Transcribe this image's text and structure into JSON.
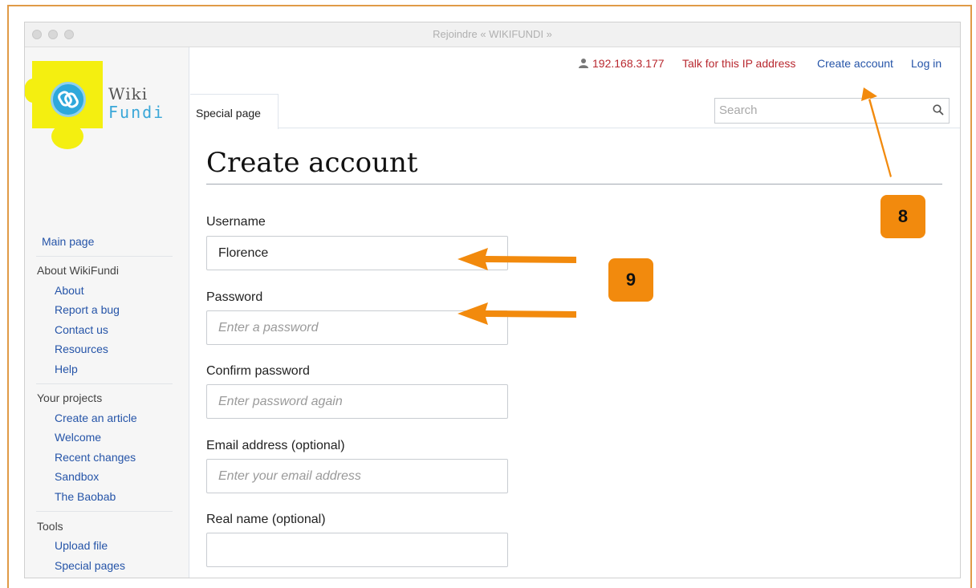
{
  "window": {
    "title": "Rejoindre « WIKIFUNDI »"
  },
  "personal_bar": {
    "ip": "192.168.3.177",
    "talk": "Talk for this IP address",
    "create_account": "Create account",
    "login": "Log in"
  },
  "logo": {
    "line1": "Wiki",
    "line2": "Fundi"
  },
  "sidebar": {
    "main_page": "Main page",
    "about_heading": "About WikiFundi",
    "about_items": [
      "About",
      "Report a bug",
      "Contact us",
      "Resources",
      "Help"
    ],
    "projects_heading": "Your projects",
    "projects_items": [
      "Create an article",
      "Welcome",
      "Recent changes",
      "Sandbox",
      "The Baobab"
    ],
    "tools_heading": "Tools",
    "tools_items": [
      "Upload file",
      "Special pages"
    ]
  },
  "tabs": {
    "special_page": "Special page"
  },
  "search": {
    "placeholder": "Search"
  },
  "page": {
    "title": "Create account"
  },
  "form": {
    "username_label": "Username",
    "username_value": "Florence",
    "password_label": "Password",
    "password_placeholder": "Enter a password",
    "confirm_label": "Confirm password",
    "confirm_placeholder": "Enter password again",
    "email_label": "Email address (optional)",
    "email_placeholder": "Enter your email address",
    "realname_label": "Real name (optional)",
    "realname_value": ""
  },
  "annotations": {
    "badge_8": "8",
    "badge_9": "9"
  },
  "colors": {
    "accent_orange": "#f28a0d",
    "link_blue": "#2554a8",
    "link_red": "#b8282f",
    "logo_yellow": "#f4ef10",
    "logo_blue": "#2ea8db"
  }
}
